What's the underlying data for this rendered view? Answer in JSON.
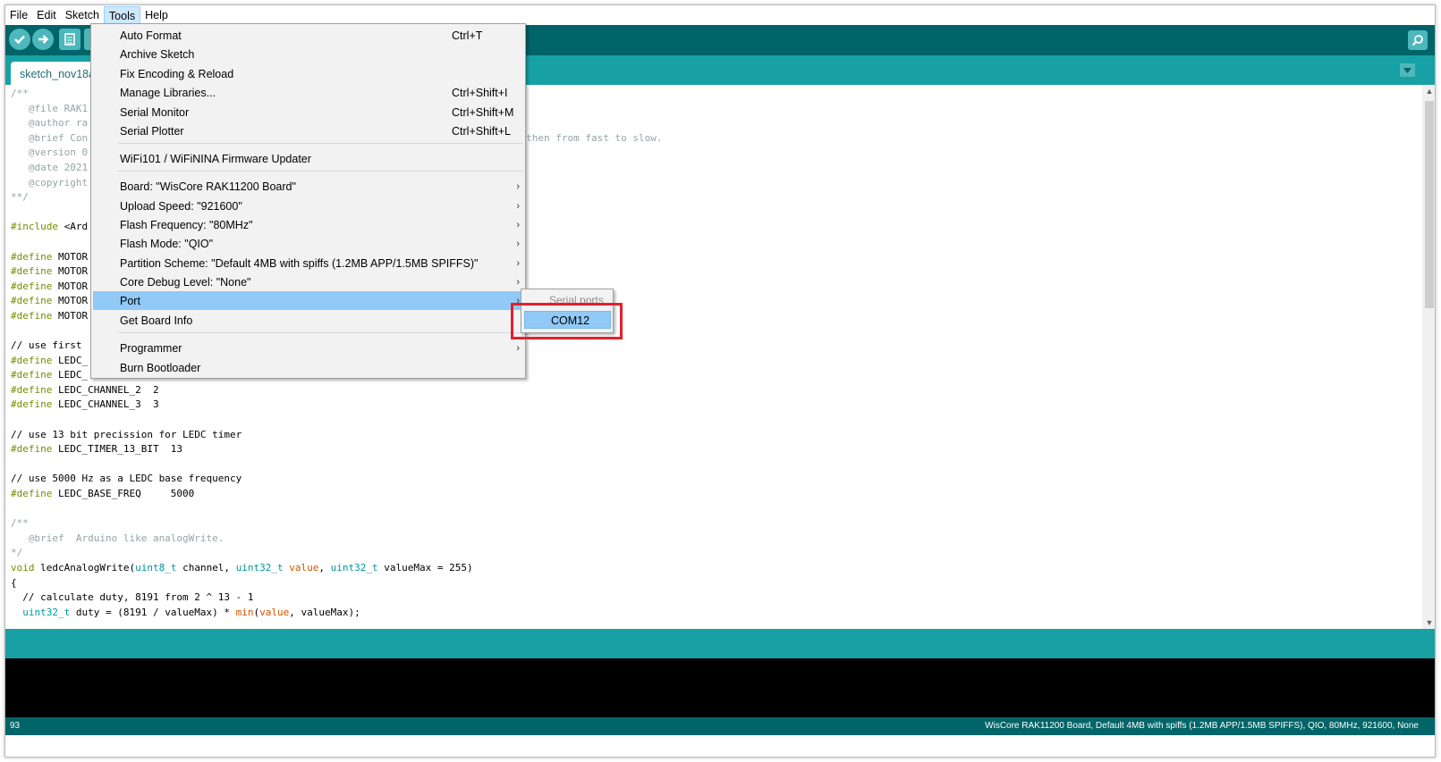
{
  "menubar": {
    "items": [
      "File",
      "Edit",
      "Sketch",
      "Tools",
      "Help"
    ],
    "active": "Tools"
  },
  "toolbar": {
    "buttons": [
      "verify-icon",
      "upload-icon",
      "new-icon",
      "open-icon",
      "save-icon"
    ],
    "right": "serial-monitor-icon"
  },
  "tab": {
    "label": "sketch_nov18a"
  },
  "code_lines": [
    [
      [
        "cm",
        "/**"
      ]
    ],
    [
      [
        "cm",
        "   @file RAK1"
      ]
    ],
    [
      [
        "cm",
        "   @author ra"
      ]
    ],
    [
      [
        "cm",
        "   @brief Con                                                                      and then from fast to slow."
      ]
    ],
    [
      [
        "cm",
        "   @version 0"
      ]
    ],
    [
      [
        "cm",
        "   @date 2021"
      ]
    ],
    [
      [
        "cm",
        "   @copyright"
      ]
    ],
    [
      [
        "cm",
        "**/"
      ]
    ],
    [],
    [
      [
        "kw",
        "#include"
      ],
      [
        "",
        " <Ard"
      ]
    ],
    [],
    [
      [
        "kw",
        "#define"
      ],
      [
        "",
        " MOTOR"
      ]
    ],
    [
      [
        "kw",
        "#define"
      ],
      [
        "",
        " MOTOR"
      ]
    ],
    [
      [
        "kw",
        "#define"
      ],
      [
        "",
        " MOTOR"
      ]
    ],
    [
      [
        "kw",
        "#define"
      ],
      [
        "",
        " MOTOR"
      ]
    ],
    [
      [
        "kw",
        "#define"
      ],
      [
        "",
        " MOTOR"
      ]
    ],
    [],
    [
      [
        "",
        "// use first"
      ]
    ],
    [
      [
        "kw",
        "#define"
      ],
      [
        "",
        " LEDC_"
      ]
    ],
    [
      [
        "kw",
        "#define"
      ],
      [
        "",
        " LEDC_"
      ]
    ],
    [
      [
        "kw",
        "#define"
      ],
      [
        "",
        " LEDC_CHANNEL_2  2"
      ]
    ],
    [
      [
        "kw",
        "#define"
      ],
      [
        "",
        " LEDC_CHANNEL_3  3"
      ]
    ],
    [],
    [
      [
        "",
        "// use 13 bit precission for LEDC timer"
      ]
    ],
    [
      [
        "kw",
        "#define"
      ],
      [
        "",
        " LEDC_TIMER_13_BIT  13"
      ]
    ],
    [],
    [
      [
        "",
        "// use 5000 Hz as a LEDC base frequency"
      ]
    ],
    [
      [
        "kw",
        "#define"
      ],
      [
        "",
        " LEDC_BASE_FREQ     5000"
      ]
    ],
    [],
    [
      [
        "cm",
        "/**"
      ]
    ],
    [
      [
        "cm",
        "   @brief  Arduino like analogWrite."
      ]
    ],
    [
      [
        "cm",
        "*/"
      ]
    ],
    [
      [
        "kw",
        "void"
      ],
      [
        "",
        " ledcAnalogWrite("
      ],
      [
        "ty",
        "uint8_t"
      ],
      [
        "",
        " channel, "
      ],
      [
        "ty",
        "uint32_t"
      ],
      [
        "fn",
        " value"
      ],
      [
        "",
        ", "
      ],
      [
        "ty",
        "uint32_t"
      ],
      [
        "",
        " valueMax = 255)"
      ]
    ],
    [
      [
        "",
        "{"
      ]
    ],
    [
      [
        "",
        "  // calculate duty, 8191 from 2 ^ 13 - 1"
      ]
    ],
    [
      [
        "ty",
        "  uint32_t"
      ],
      [
        "",
        " duty = (8191 / valueMax) * "
      ],
      [
        "fn",
        "min"
      ],
      [
        "",
        "("
      ],
      [
        "fn",
        "value"
      ],
      [
        "",
        ", valueMax);"
      ]
    ]
  ],
  "tools_menu": [
    {
      "label": "Auto Format",
      "shortcut": "Ctrl+T"
    },
    {
      "label": "Archive Sketch",
      "shortcut": ""
    },
    {
      "label": "Fix Encoding & Reload",
      "shortcut": ""
    },
    {
      "label": "Manage Libraries...",
      "shortcut": "Ctrl+Shift+I"
    },
    {
      "label": "Serial Monitor",
      "shortcut": "Ctrl+Shift+M"
    },
    {
      "label": "Serial Plotter",
      "shortcut": "Ctrl+Shift+L"
    },
    {
      "label": "WiFi101 / WiFiNINA Firmware Updater",
      "shortcut": ""
    },
    {
      "label": "Board: \"WisCore RAK11200 Board\"",
      "shortcut": "",
      "submenu": true
    },
    {
      "label": "Upload Speed: \"921600\"",
      "shortcut": "",
      "submenu": true
    },
    {
      "label": "Flash Frequency: \"80MHz\"",
      "shortcut": "",
      "submenu": true
    },
    {
      "label": "Flash Mode: \"QIO\"",
      "shortcut": "",
      "submenu": true
    },
    {
      "label": "Partition Scheme: \"Default 4MB with spiffs (1.2MB APP/1.5MB SPIFFS)\"",
      "shortcut": "",
      "submenu": true
    },
    {
      "label": "Core Debug Level: \"None\"",
      "shortcut": "",
      "submenu": true
    },
    {
      "label": "Port",
      "shortcut": "",
      "submenu": true,
      "highlighted": true
    },
    {
      "label": "Get Board Info",
      "shortcut": ""
    },
    {
      "label": "Programmer",
      "shortcut": "",
      "submenu": true
    },
    {
      "label": "Burn Bootloader",
      "shortcut": ""
    }
  ],
  "port_submenu": {
    "header": "Serial ports",
    "item": "COM12"
  },
  "footer": {
    "line": "93",
    "board": "WisCore RAK11200 Board, Default 4MB with spiffs (1.2MB APP/1.5MB SPIFFS), QIO, 80MHz, 921600, None"
  },
  "colors": {
    "toolbar": "#006468",
    "tabbar": "#17a1a5",
    "highlight": "#91c9f7",
    "annotation": "#e51f2b"
  }
}
